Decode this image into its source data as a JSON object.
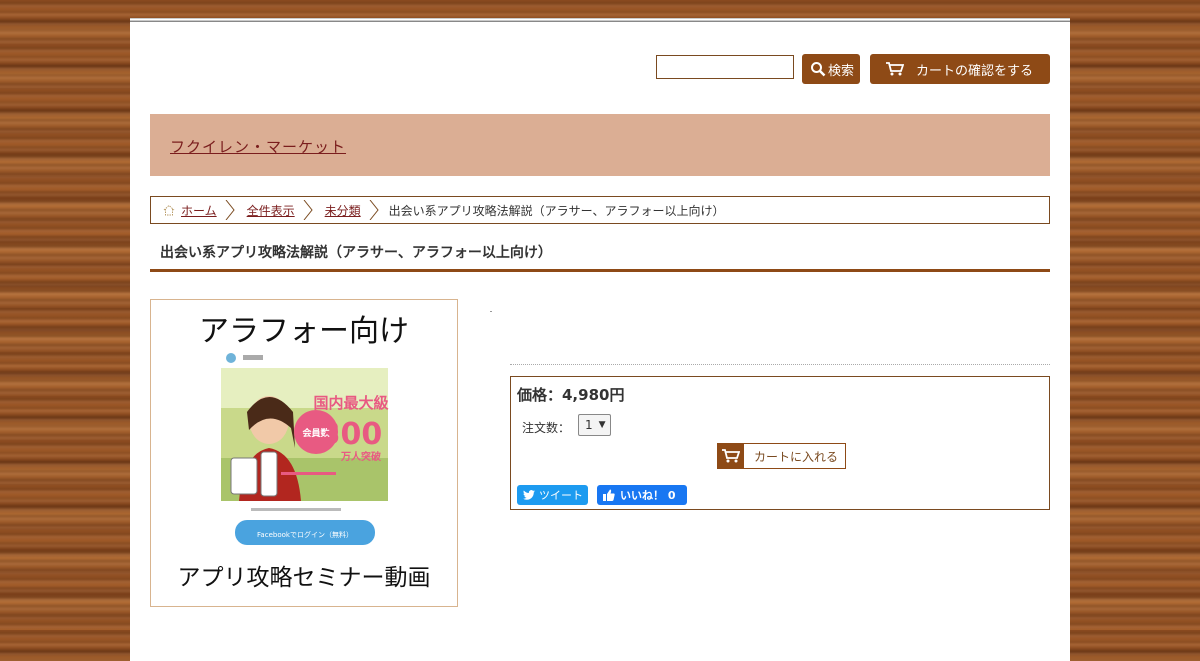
{
  "header": {
    "search_button_label": "検索",
    "cart_button_label": "カートの確認をする",
    "shop_name": "フクイレン・マーケット"
  },
  "breadcrumb": {
    "items": [
      "ホーム",
      "全件表示",
      "未分類"
    ],
    "current": "出会い系アプリ攻略法解説（アラサー、アラフォー以上向け）"
  },
  "product": {
    "title": "出会い系アプリ攻略法解説（アラサー、アラフォー以上向け）",
    "image_heading": "アラフォー向け",
    "image_footer": "アプリ攻略セミナー動画",
    "image_banner_big": "国内最大級",
    "image_banner_num": "300",
    "image_banner_unit": "万人突破",
    "image_fb_button": "Facebookでログイン（無料）",
    "price": "価格：4,980円",
    "qty_label": "注文数：",
    "qty_value": "1",
    "add_to_cart": "カートに入れる",
    "tweet": "ツイート",
    "like": "いいね！ 0"
  },
  "colors": {
    "accent": "#8e4a16",
    "band": "#dbae94",
    "link": "#7a1d1d",
    "twitter": "#1d9bf0",
    "facebook": "#1877f2"
  }
}
